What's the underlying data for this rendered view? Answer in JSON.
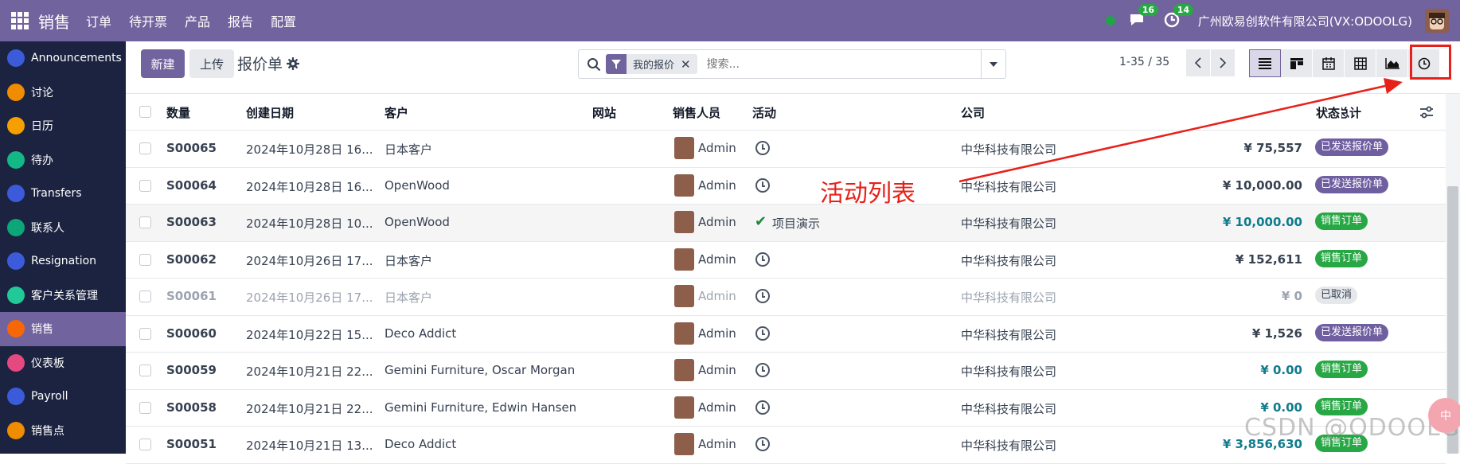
{
  "topbar": {
    "app": "销售",
    "menus": [
      "订单",
      "待开票",
      "产品",
      "报告",
      "配置"
    ],
    "chat_count": "16",
    "activity_count": "14",
    "company": "广州欧易创软件有限公司(VX:ODOOLG)"
  },
  "sidebar": {
    "items": [
      {
        "label": "Announcements",
        "color": "#3b5bdb"
      },
      {
        "label": "讨论",
        "color": "#f08c00"
      },
      {
        "label": "日历",
        "color": "#f59f00"
      },
      {
        "label": "待办",
        "color": "#12b886"
      },
      {
        "label": "Transfers",
        "color": "#3b5bdb"
      },
      {
        "label": "联系人",
        "color": "#0ca678"
      },
      {
        "label": "Resignation",
        "color": "#3b5bdb"
      },
      {
        "label": "客户关系管理",
        "color": "#20c997"
      },
      {
        "label": "销售",
        "color": "#f76707"
      },
      {
        "label": "仪表板",
        "color": "#e64980"
      },
      {
        "label": "Payroll",
        "color": "#3b5bdb"
      },
      {
        "label": "销售点",
        "color": "#f08c00"
      }
    ],
    "active_index": 8
  },
  "control": {
    "new_label": "新建",
    "upload_label": "上传",
    "title": "报价单",
    "facet": "我的报价",
    "search_placeholder": "搜索...",
    "pager": "1-35 / 35"
  },
  "columns": [
    "数量",
    "创建日期",
    "客户",
    "网站",
    "销售人员",
    "活动",
    "公司",
    "总计",
    "状态"
  ],
  "rows": [
    {
      "ref": "S00065",
      "date": "2024年10月28日 16...",
      "customer": "日本客户",
      "salesperson": "Admin",
      "activity": "",
      "company": "中华科技有限公司",
      "total": "¥ 75,557",
      "status": "已发送报价单",
      "status_type": "purple",
      "blue": false,
      "muted": false
    },
    {
      "ref": "S00064",
      "date": "2024年10月28日 16...",
      "customer": "OpenWood",
      "salesperson": "Admin",
      "activity": "",
      "company": "中华科技有限公司",
      "total": "¥ 10,000.00",
      "status": "已发送报价单",
      "status_type": "purple",
      "blue": false,
      "muted": false
    },
    {
      "ref": "S00063",
      "date": "2024年10月28日 10...",
      "customer": "OpenWood",
      "salesperson": "Admin",
      "activity": "项目演示",
      "company": "中华科技有限公司",
      "total": "¥ 10,000.00",
      "status": "销售订单",
      "status_type": "green",
      "blue": true,
      "muted": false
    },
    {
      "ref": "S00062",
      "date": "2024年10月26日 17...",
      "customer": "日本客户",
      "salesperson": "Admin",
      "activity": "",
      "company": "中华科技有限公司",
      "total": "¥ 152,611",
      "status": "销售订单",
      "status_type": "green",
      "blue": false,
      "muted": false
    },
    {
      "ref": "S00061",
      "date": "2024年10月26日 17...",
      "customer": "日本客户",
      "salesperson": "Admin",
      "activity": "",
      "company": "中华科技有限公司",
      "total": "¥ 0",
      "status": "已取消",
      "status_type": "grey",
      "blue": false,
      "muted": true
    },
    {
      "ref": "S00060",
      "date": "2024年10月22日 15...",
      "customer": "Deco Addict",
      "salesperson": "Admin",
      "activity": "",
      "company": "中华科技有限公司",
      "total": "¥ 1,526",
      "status": "已发送报价单",
      "status_type": "purple",
      "blue": false,
      "muted": false
    },
    {
      "ref": "S00059",
      "date": "2024年10月21日 22...",
      "customer": "Gemini Furniture, Oscar Morgan",
      "salesperson": "Admin",
      "activity": "",
      "company": "中华科技有限公司",
      "total": "¥ 0.00",
      "status": "销售订单",
      "status_type": "green",
      "blue": true,
      "muted": false
    },
    {
      "ref": "S00058",
      "date": "2024年10月21日 22...",
      "customer": "Gemini Furniture, Edwin Hansen",
      "salesperson": "Admin",
      "activity": "",
      "company": "中华科技有限公司",
      "total": "¥ 0.00",
      "status": "销售订单",
      "status_type": "green",
      "blue": true,
      "muted": false
    },
    {
      "ref": "S00051",
      "date": "2024年10月21日 13...",
      "customer": "Deco Addict",
      "salesperson": "Admin",
      "activity": "",
      "company": "中华科技有限公司",
      "total": "¥ 3,856,630",
      "status": "销售订单",
      "status_type": "green",
      "blue": true,
      "muted": false
    }
  ],
  "annotation": "活动列表",
  "watermark": "CSDN @ODOOLG",
  "floating_text": "中",
  "colors": {
    "primary": "#71639e",
    "annotation_red": "#e8201a"
  }
}
